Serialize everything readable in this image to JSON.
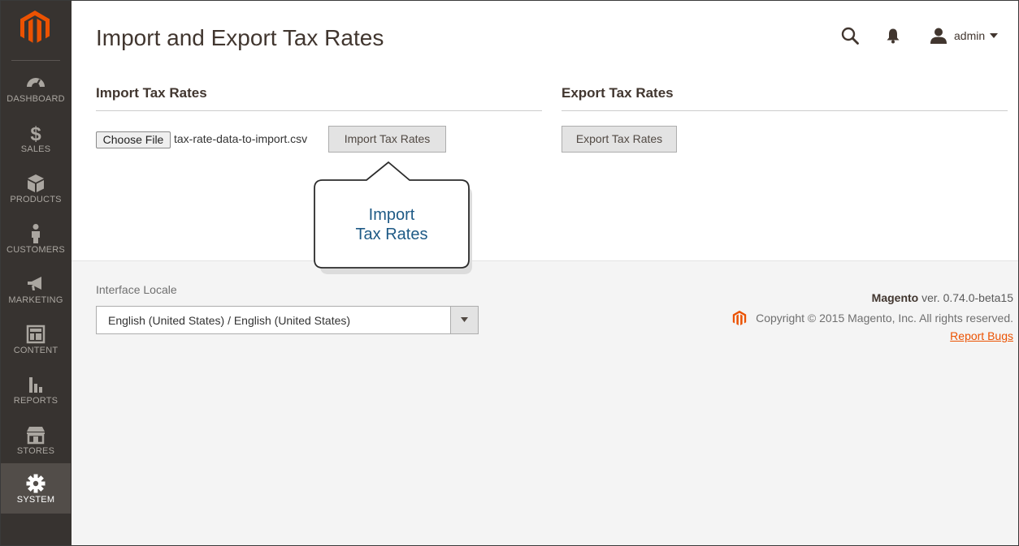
{
  "page": {
    "title": "Import and Export Tax Rates"
  },
  "header": {
    "username": "admin",
    "icons": [
      "search-icon",
      "bell-icon",
      "user-icon",
      "chevron-down-icon"
    ]
  },
  "sidebar": {
    "items": [
      {
        "label": "DASHBOARD",
        "icon": "dashboard-icon",
        "active": false
      },
      {
        "label": "SALES",
        "icon": "dollar-icon",
        "active": false
      },
      {
        "label": "PRODUCTS",
        "icon": "box-icon",
        "active": false
      },
      {
        "label": "CUSTOMERS",
        "icon": "person-icon",
        "active": false
      },
      {
        "label": "MARKETING",
        "icon": "megaphone-icon",
        "active": false
      },
      {
        "label": "CONTENT",
        "icon": "layout-icon",
        "active": false
      },
      {
        "label": "REPORTS",
        "icon": "bar-chart-icon",
        "active": false
      },
      {
        "label": "STORES",
        "icon": "store-icon",
        "active": false
      },
      {
        "label": "SYSTEM",
        "icon": "gear-icon",
        "active": true
      }
    ]
  },
  "import_section": {
    "title": "Import Tax Rates",
    "choose_file_label": "Choose File",
    "file_name": "tax-rate-data-to-import.csv",
    "button_label": "Import Tax Rates"
  },
  "export_section": {
    "title": "Export Tax Rates",
    "button_label": "Export Tax Rates"
  },
  "callout": {
    "line1": "Import",
    "line2": "Tax Rates"
  },
  "footer": {
    "locale_label": "Interface Locale",
    "locale_value": "English (United States) / English (United States)",
    "brand": "Magento",
    "version": " ver. 0.74.0-beta15",
    "copyright": "Copyright © 2015 Magento, Inc. All rights reserved.",
    "report_bugs": "Report Bugs"
  },
  "colors": {
    "sidebar_bg": "#373330",
    "accent": "#eb5202",
    "callout_text": "#1e5a86"
  }
}
